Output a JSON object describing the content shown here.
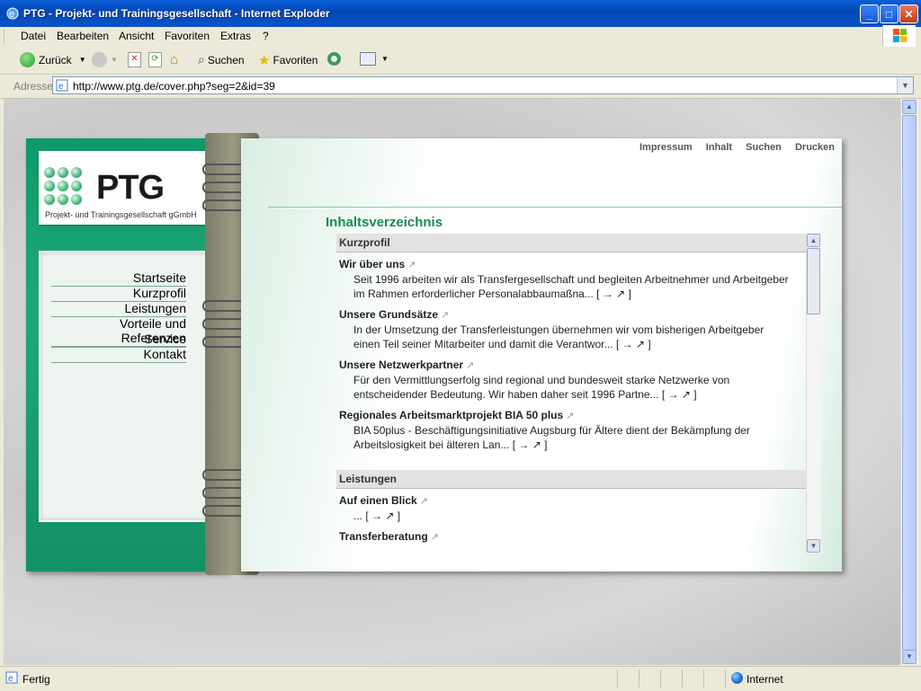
{
  "window": {
    "title": "PTG - Projekt- und Trainingsgesellschaft - Internet Exploder",
    "min": "_",
    "max": "□",
    "close": "✕"
  },
  "menu": [
    "Datei",
    "Bearbeiten",
    "Ansicht",
    "Favoriten",
    "Extras",
    "?"
  ],
  "toolbar": {
    "back": "Zurück",
    "search": "Suchen",
    "favorites": "Favoriten"
  },
  "address": {
    "label": "Adresse",
    "url": "http://www.ptg.de/cover.php?seg=2&id=39"
  },
  "status": {
    "text": "Fertig",
    "zone": "Internet"
  },
  "page": {
    "logo_text": "PTG",
    "logo_sub": "Projekt- und Trainingsgesellschaft gGmbH",
    "nav": [
      "Startseite",
      "Kurzprofil",
      "Leistungen",
      "Vorteile und Referenzen",
      "Service",
      "Kontakt"
    ],
    "toplinks": [
      "Impressum",
      "Inhalt",
      "Suchen",
      "Drucken"
    ],
    "heading": "Inhaltsverzeichnis",
    "sections": [
      {
        "title": "Kurzprofil",
        "entries": [
          {
            "title": "Wir über uns",
            "lines": [
              "Seit 1996 arbeiten wir als Transfergesellschaft und begleiten Arbeitnehmer und Arbeitgeber",
              "im Rahmen erforderlicher Personalabbaumaßna... [ → ↗ ]"
            ]
          },
          {
            "title": "Unsere Grundsätze",
            "lines": [
              "In der Umsetzung der Transferleistungen übernehmen wir vom bisherigen Arbeitgeber",
              "einen Teil seiner Mitarbeiter und damit die Verantwor... [ → ↗ ]"
            ]
          },
          {
            "title": "Unsere Netzwerkpartner",
            "lines": [
              "Für den Vermittlungserfolg sind regional und bundesweit starke Netzwerke von",
              "entscheidender Bedeutung. Wir haben daher seit 1996 Partne... [ → ↗ ]"
            ]
          },
          {
            "title": "Regionales Arbeitsmarktprojekt BIA 50 plus",
            "lines": [
              "BIA 50plus - Beschäftigungsinitiative Augsburg für Ältere dient der Bekämpfung der",
              "Arbeitslosigkeit bei älteren Lan... [ → ↗ ]"
            ]
          }
        ]
      },
      {
        "title": "Leistungen",
        "entries": [
          {
            "title": "Auf einen Blick",
            "lines": [
              "... [ → ↗ ]"
            ]
          },
          {
            "title": "Transferberatung",
            "lines": []
          }
        ]
      }
    ]
  }
}
